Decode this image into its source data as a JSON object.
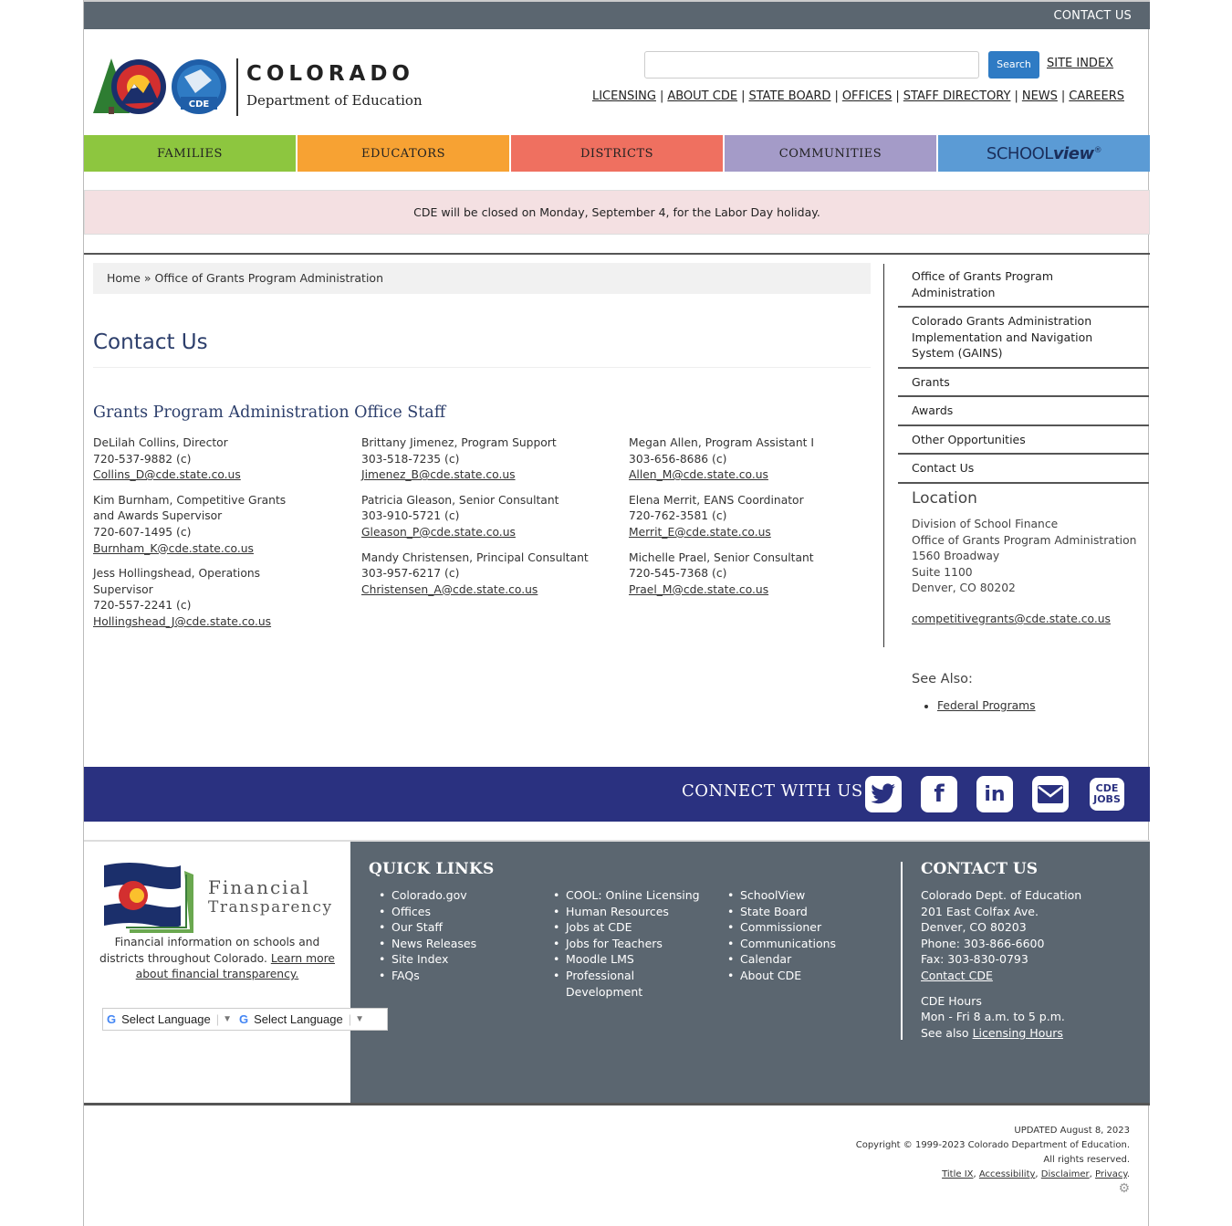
{
  "topbar": {
    "contact_us": "CONTACT US"
  },
  "header": {
    "logo_line1": "COLORADO",
    "logo_line2": "Department of Education",
    "logo_badge": "CDE",
    "search_placeholder": "",
    "search_button": "Search",
    "site_index": "SITE INDEX",
    "links": [
      "LICENSING",
      "ABOUT CDE",
      "STATE BOARD",
      "OFFICES",
      "STAFF DIRECTORY",
      "NEWS",
      "CAREERS"
    ]
  },
  "nav": {
    "tabs": [
      {
        "label": "FAMILIES",
        "color": "#8dc63f"
      },
      {
        "label": "EDUCATORS",
        "color": "#f7a233"
      },
      {
        "label": "DISTRICTS",
        "color": "#ef7060"
      },
      {
        "label": "COMMUNITIES",
        "color": "#a49bc8"
      }
    ],
    "schoolview": {
      "school": "SCHOOL",
      "view": "view",
      "mark": "®",
      "color": "#5b9bd5"
    }
  },
  "alert": {
    "text": "CDE will be closed on Monday, September 4, for the Labor Day holiday."
  },
  "breadcrumb": {
    "home": "Home",
    "sep": " » ",
    "current": "Office of Grants Program Administration"
  },
  "main": {
    "title": "Contact Us",
    "section_title": "Grants Program Administration Office Staff",
    "columns": [
      [
        {
          "name": "DeLilah Collins, Director",
          "phone": "720-537-9882 (c)",
          "email": "Collins_D@cde.state.co.us"
        },
        {
          "name": "Kim Burnham, Competitive Grants and Awards Supervisor",
          "phone": "720-607-1495 (c)",
          "email": "Burnham_K@cde.state.co.us"
        },
        {
          "name": "Jess Hollingshead, Operations Supervisor",
          "phone": "720-557-2241 (c)",
          "email": "Hollingshead_J@cde.state.co.us"
        }
      ],
      [
        {
          "name": "Brittany Jimenez, Program Support",
          "phone": "303-518-7235 (c)",
          "email": "Jimenez_B@cde.state.co.us"
        },
        {
          "name": "Patricia Gleason, Senior Consultant",
          "phone": "303-910-5721 (c)",
          "email": "Gleason_P@cde.state.co.us"
        },
        {
          "name": "Mandy Christensen, Principal Consultant",
          "phone": "303-957-6217 (c)",
          "email": "Christensen_A@cde.state.co.us"
        }
      ],
      [
        {
          "name": "Megan Allen, Program Assistant I",
          "phone": "303-656-8686 (c)",
          "email": "Allen_M@cde.state.co.us"
        },
        {
          "name": "Elena Merrit, EANS Coordinator",
          "phone": "720-762-3581 (c)",
          "email": "Merrit_E@cde.state.co.us"
        },
        {
          "name": "Michelle Prael, Senior Consultant",
          "phone": "720-545-7368 (c)",
          "email": "Prael_M@cde.state.co.us"
        }
      ]
    ]
  },
  "sidebar": {
    "items": [
      "Office of Grants Program Administration",
      "Colorado Grants Administration Implementation and Navigation System (GAINS)",
      "Grants",
      "Awards",
      "Other Opportunities",
      "Contact Us"
    ],
    "location_title": "Location",
    "location_lines": [
      "Division of School Finance",
      "Office of Grants Program Administration",
      "1560 Broadway",
      "Suite 1100",
      "Denver, CO 80202"
    ],
    "location_email": "competitivegrants@cde.state.co.us",
    "see_also_title": "See Also:",
    "see_also_links": [
      "Federal Programs"
    ]
  },
  "connect": {
    "label": "CONNECT WITH US",
    "icons": [
      "twitter-icon",
      "facebook-icon",
      "linkedin-icon",
      "email-icon",
      "cde-jobs-icon"
    ],
    "jobs_line1": "CDE",
    "jobs_line2": "JOBS"
  },
  "footer": {
    "fin_line1": "Financial",
    "fin_line2": "Transparency",
    "fin_desc": "Financial information on schools and districts throughout Colorado.",
    "fin_link": "Learn more about financial transparency.",
    "translate_label": "Select Language",
    "quick_links_title": "QUICK LINKS",
    "quick_links": [
      [
        "Colorado.gov",
        "Offices",
        "Our Staff",
        "News Releases",
        "Site Index",
        "FAQs"
      ],
      [
        "COOL: Online Licensing",
        "Human Resources",
        "Jobs at CDE",
        "Jobs for Teachers",
        "Moodle LMS",
        "Professional Development"
      ],
      [
        "SchoolView",
        "State Board",
        "Commissioner",
        "Communications",
        "Calendar",
        "About CDE"
      ]
    ],
    "contact_title": "CONTACT US",
    "contact_lines": [
      "Colorado Dept. of Education",
      "201 East Colfax Ave.",
      "Denver, CO 80203",
      "Phone: 303-866-6600",
      "Fax: 303-830-0793"
    ],
    "contact_link": "Contact CDE",
    "hours_title": "CDE Hours",
    "hours_text": "Mon - Fri 8 a.m. to 5 p.m.",
    "see_also_prefix": "See also ",
    "licensing_hours": "Licensing Hours"
  },
  "legal": {
    "updated": "UPDATED August 8, 2023",
    "copyright": "Copyright © 1999-2023 Colorado Department of Education.",
    "rights": "All rights reserved.",
    "links": [
      "Title IX",
      "Accessibility",
      "Disclaimer",
      "Privacy"
    ]
  }
}
